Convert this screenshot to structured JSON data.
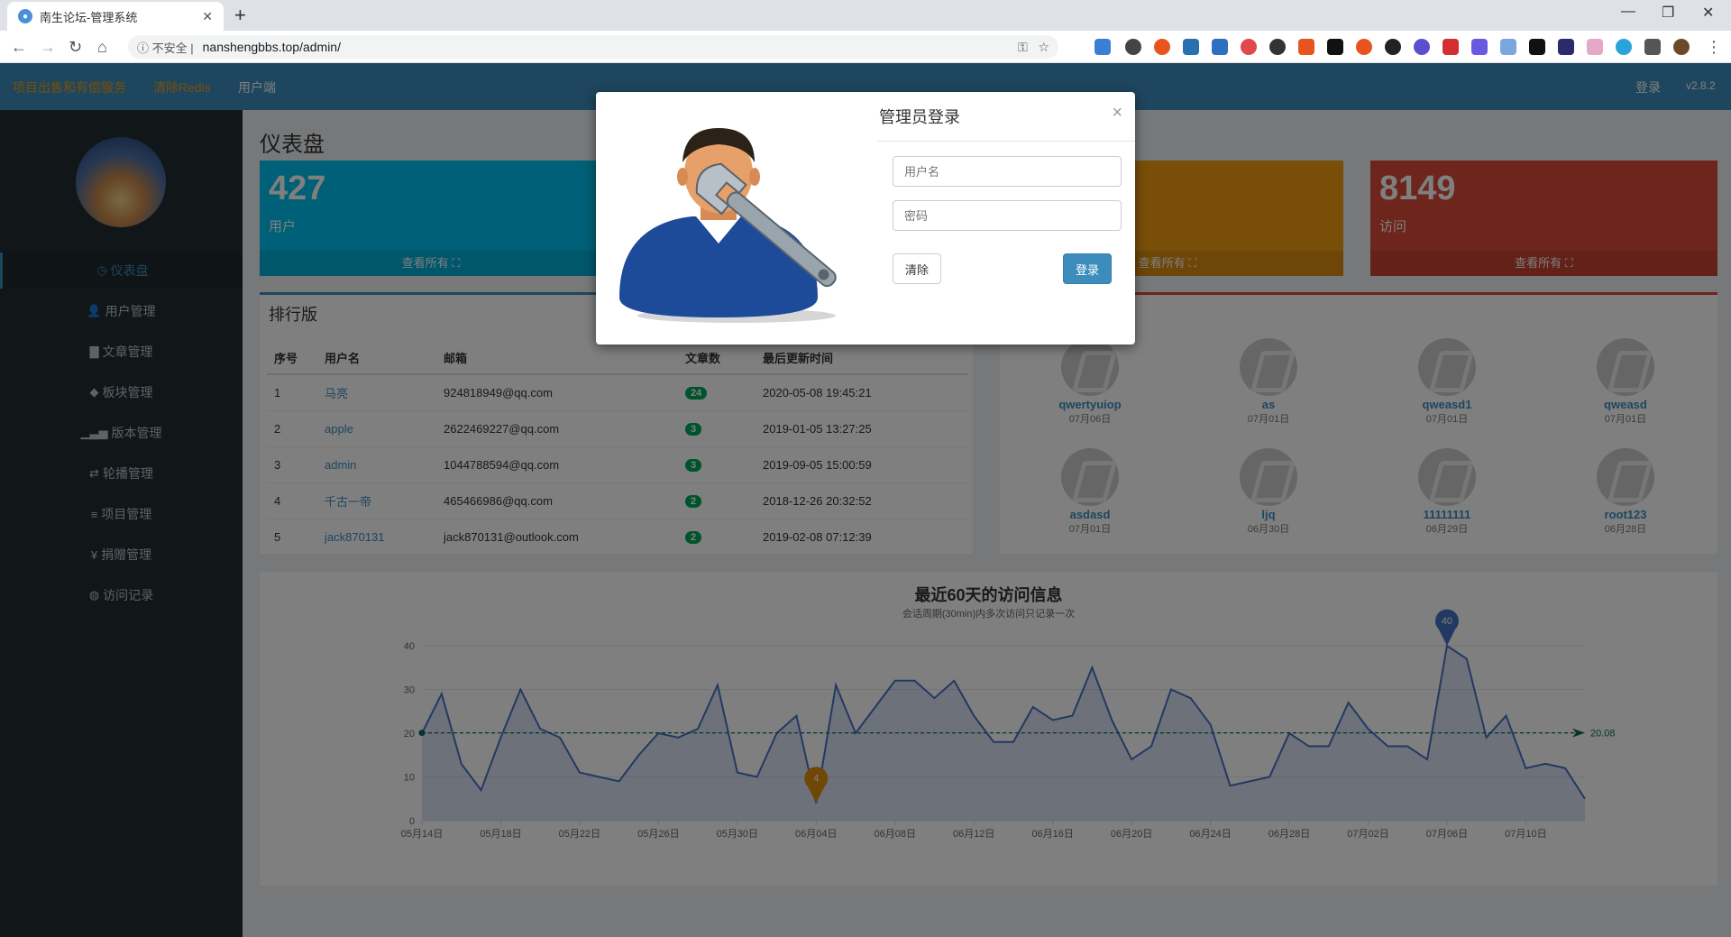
{
  "browser": {
    "tab_title": "南生论坛-管理系统",
    "security_label": "不安全",
    "url": "nanshengbbs.top/admin/"
  },
  "header": {
    "links": [
      "项目出售和有偿服务",
      "清除Redis",
      "用户端"
    ],
    "login": "登录",
    "version": "v2.8.2"
  },
  "sidebar": {
    "items": [
      {
        "label": "仪表盘",
        "icon": "dashboard-icon",
        "glyph": "◷"
      },
      {
        "label": "用户管理",
        "icon": "user-icon",
        "glyph": "👤"
      },
      {
        "label": "文章管理",
        "icon": "book-icon",
        "glyph": "▇"
      },
      {
        "label": "板块管理",
        "icon": "tag-icon",
        "glyph": "◆"
      },
      {
        "label": "版本管理",
        "icon": "signal-icon",
        "glyph": "▁▃▅"
      },
      {
        "label": "轮播管理",
        "icon": "retweet-icon",
        "glyph": "⇄"
      },
      {
        "label": "项目管理",
        "icon": "tasks-icon",
        "glyph": "≡"
      },
      {
        "label": "捐赠管理",
        "icon": "yen-icon",
        "glyph": "¥"
      },
      {
        "label": "访问记录",
        "icon": "globe-icon",
        "glyph": "◍"
      }
    ]
  },
  "dashboard": {
    "title": "仪表盘",
    "stats": [
      {
        "value": "427",
        "label": "用户",
        "footer": "查看所有 ⛶",
        "color": "#00c0ef"
      },
      {
        "value": "",
        "label": "",
        "footer": "查看所有 ⛶",
        "color": "#f39c12"
      },
      {
        "value": "8149",
        "label": "访问",
        "footer": "查看所有 ⛶",
        "color": "#dd4b39"
      }
    ]
  },
  "ranking": {
    "title": "排行版",
    "headers": [
      "序号",
      "用户名",
      "邮箱",
      "文章数",
      "最后更新时间"
    ],
    "rows": [
      {
        "no": "1",
        "name": "马亮",
        "email": "924818949@qq.com",
        "count": "24",
        "time": "2020-05-08 19:45:21"
      },
      {
        "no": "2",
        "name": "apple",
        "email": "2622469227@qq.com",
        "count": "3",
        "time": "2019-01-05 13:27:25"
      },
      {
        "no": "3",
        "name": "admin",
        "email": "1044788594@qq.com",
        "count": "3",
        "time": "2019-09-05 15:00:59"
      },
      {
        "no": "4",
        "name": "千古一帝",
        "email": "465466986@qq.com",
        "count": "2",
        "time": "2018-12-26 20:32:52"
      },
      {
        "no": "5",
        "name": "jack870131",
        "email": "jack870131@outlook.com",
        "count": "2",
        "time": "2019-02-08 07:12:39"
      }
    ]
  },
  "members": [
    {
      "name": "qwertyuiop",
      "date": "07月06日"
    },
    {
      "name": "as",
      "date": "07月01日"
    },
    {
      "name": "qweasd1",
      "date": "07月01日"
    },
    {
      "name": "qweasd",
      "date": "07月01日"
    },
    {
      "name": "asdasd",
      "date": "07月01日"
    },
    {
      "name": "ljq",
      "date": "06月30日"
    },
    {
      "name": "11111111",
      "date": "06月29日"
    },
    {
      "name": "root123",
      "date": "06月28日"
    }
  ],
  "chart_data": {
    "type": "area",
    "title": "最近60天的访问信息",
    "subtitle": "会话周期(30min)内多次访问只记录一次",
    "ylim": [
      0,
      40
    ],
    "yticks": [
      0,
      10,
      20,
      30,
      40
    ],
    "xticks": [
      "05月14日",
      "05月18日",
      "05月22日",
      "05月26日",
      "05月30日",
      "06月04日",
      "06月08日",
      "06月12日",
      "06月16日",
      "06月20日",
      "06月24日",
      "06月28日",
      "07月02日",
      "07月06日",
      "07月10日"
    ],
    "values": [
      20,
      29,
      13,
      7,
      19,
      30,
      21,
      19,
      11,
      10,
      9,
      15,
      20,
      19,
      21,
      31,
      11,
      10,
      20,
      24,
      4,
      31,
      20,
      26,
      32,
      32,
      28,
      32,
      24,
      18,
      18,
      26,
      23,
      24,
      35,
      23,
      14,
      17,
      30,
      28,
      22,
      8,
      9,
      10,
      20,
      17,
      17,
      27,
      21,
      17,
      17,
      14,
      40,
      37,
      19,
      24,
      12,
      13,
      12,
      5
    ],
    "average": 20.08,
    "average_label": "20.08",
    "max_label": "40",
    "min_label": "4",
    "line_color": "#4572c4",
    "avg_color": "#0e6b5b",
    "min_color": "#e08e0b"
  },
  "modal": {
    "title": "管理员登录",
    "close": "×",
    "username_placeholder": "用户名",
    "password_placeholder": "密码",
    "clear": "清除",
    "login": "登录"
  }
}
